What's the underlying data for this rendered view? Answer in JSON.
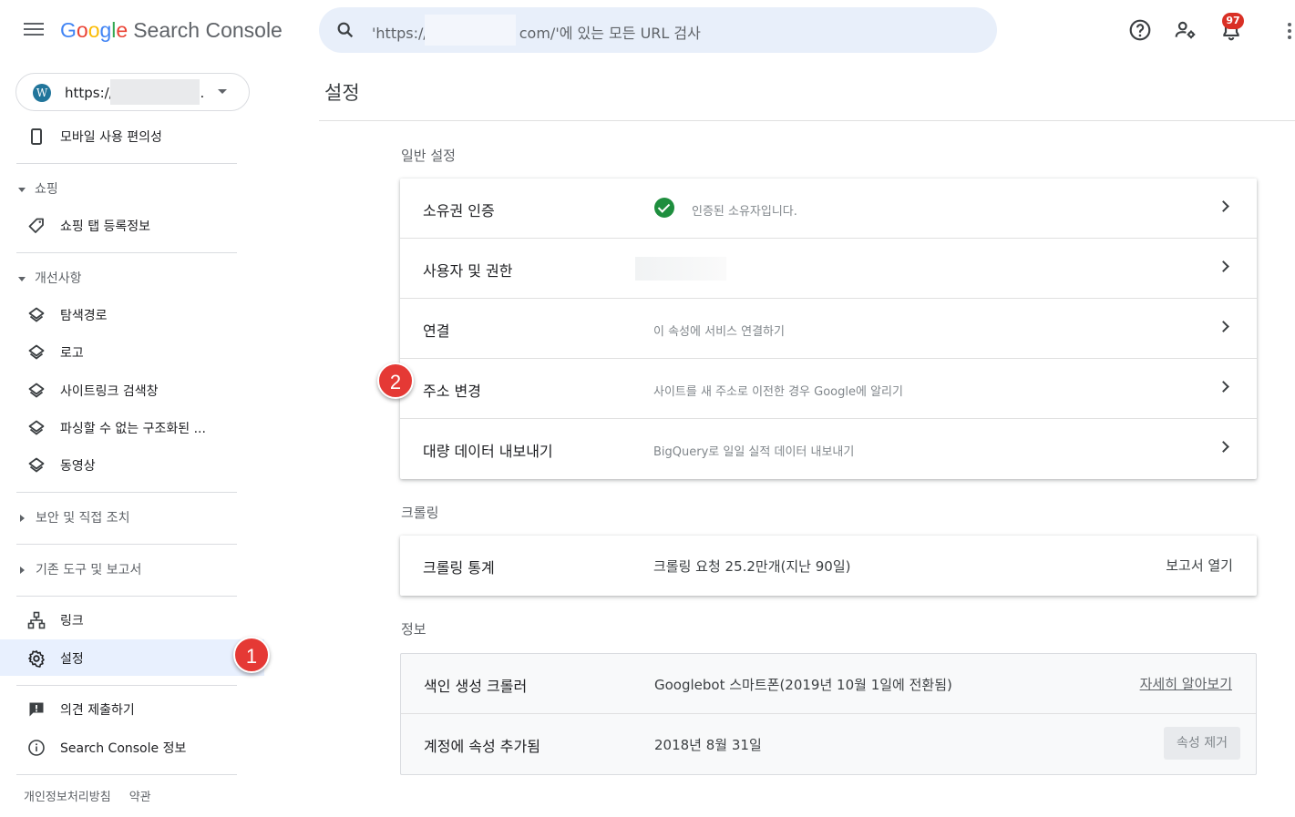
{
  "header": {
    "logo": {
      "g1": "G",
      "g2": "o",
      "g3": "o",
      "g4": "g",
      "g5": "l",
      "g6": "e",
      "rest": "Search Console"
    },
    "search_prefix": "'https://",
    "search_suffix": "com/'에 있는 모든 URL 검사",
    "notification_count": "97",
    "icons": [
      "menu-icon",
      "search-icon",
      "help-icon",
      "manage-users-icon",
      "notifications-icon",
      "more-vert-icon"
    ]
  },
  "sidebar": {
    "property_prefix": "https://",
    "property_suffix": "..",
    "items": {
      "mobile": "모바일 사용 편의성",
      "shopping_section": "쇼핑",
      "shopping_tab": "쇼핑 탭 등록정보",
      "enhancements_section": "개선사항",
      "breadcrumbs": "탐색경로",
      "logos": "로고",
      "sitelinks": "사이트링크 검색창",
      "unparsable": "파싱할 수 없는 구조화된 ...",
      "videos": "동영상",
      "security_section": "보안 및 직접 조치",
      "legacy_section": "기존 도구 및 보고서",
      "links": "링크",
      "settings": "설정",
      "feedback": "의견 제출하기",
      "about": "Search Console 정보"
    },
    "footer": {
      "privacy": "개인정보처리방침",
      "terms": "약관"
    }
  },
  "markers": {
    "one": "1",
    "two": "2"
  },
  "main": {
    "title": "설정",
    "general": {
      "title": "일반 설정",
      "rows": [
        {
          "label": "소유권 인증",
          "value": "인증된 소유자입니다."
        },
        {
          "label": "사용자 및 권한",
          "value": ""
        },
        {
          "label": "연결",
          "value": "이 속성에 서비스 연결하기"
        },
        {
          "label": "주소 변경",
          "value": "사이트를 새 주소로 이전한 경우 Google에 알리기"
        },
        {
          "label": "대량 데이터 내보내기",
          "value": "BigQuery로 일일 실적 데이터 내보내기"
        }
      ]
    },
    "crawling": {
      "title": "크롤링",
      "label": "크롤링 통계",
      "value": "크롤링 요청 25.2만개(지난 90일)",
      "action": "보고서 열기"
    },
    "about": {
      "title": "정보",
      "indexing_label": "색인 생성 크롤러",
      "indexing_value": "Googlebot 스마트폰(2019년 10월 1일에 전환됨)",
      "indexing_link": "자세히 알아보기",
      "added_label": "계정에 속성 추가됨",
      "added_value": "2018년 8월 31일",
      "remove_button": "속성 제거"
    }
  },
  "colors": {
    "accent": "#1a73e8",
    "active_bg": "#e8f0fe",
    "search_bg": "#e8effa",
    "marker": "#e53935",
    "check": "#1e8e3e"
  }
}
